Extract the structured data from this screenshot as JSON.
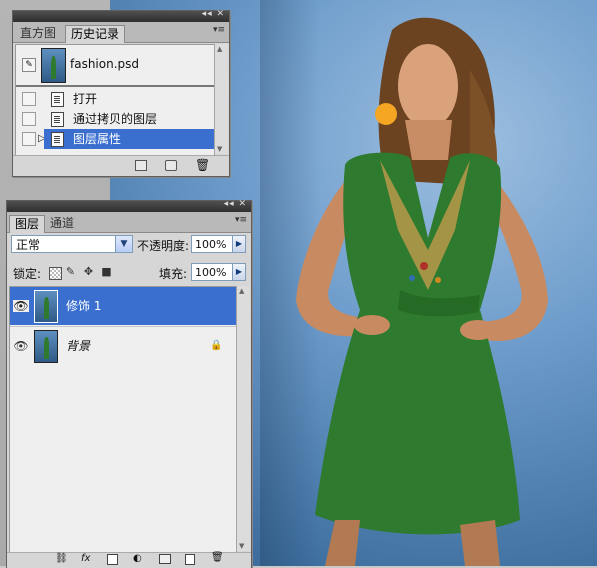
{
  "history_panel": {
    "tabs": [
      "直方图",
      "历史记录"
    ],
    "snapshot": {
      "name": "fashion.psd"
    },
    "items": [
      {
        "label": "打开",
        "selected": false
      },
      {
        "label": "通过拷贝的图层",
        "selected": false
      },
      {
        "label": "图层属性",
        "selected": true
      }
    ]
  },
  "layers_panel": {
    "tabs": [
      "图层",
      "通道"
    ],
    "blend_mode": "正常",
    "opacity_label": "不透明度:",
    "opacity_value": "100%",
    "lock_label": "锁定:",
    "fill_label": "填充:",
    "fill_value": "100%",
    "layers": [
      {
        "name": "修饰 1",
        "selected": true,
        "locked": false
      },
      {
        "name": "背景",
        "selected": false,
        "locked": true
      }
    ]
  },
  "colors": {
    "selection": "#3a6fd0",
    "background": "#5d8fc0",
    "dress": "#2e7a2e",
    "earring": "#f5a623"
  },
  "icons": [
    "history-brush-icon",
    "history-state-icon",
    "new-document-icon",
    "camera-icon",
    "trash-icon",
    "eye-icon",
    "lock-icon",
    "link-icon",
    "fx-icon",
    "mask-icon",
    "adjustment-icon",
    "folder-icon",
    "new-layer-icon"
  ]
}
